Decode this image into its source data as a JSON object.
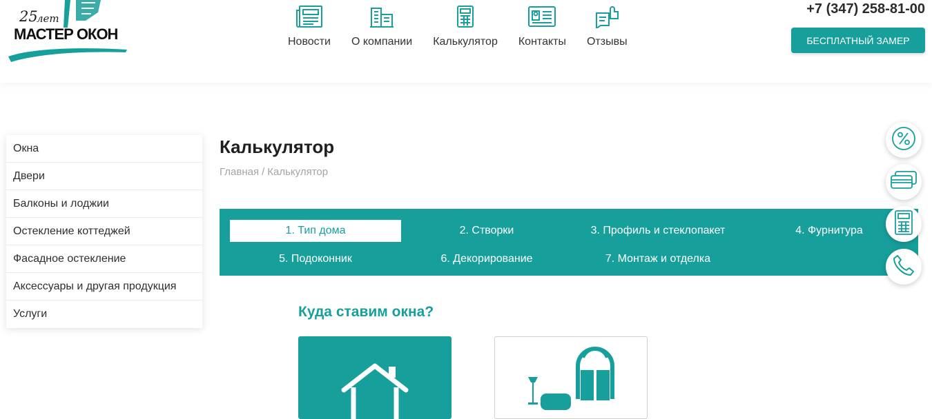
{
  "colors": {
    "accent": "#179f9c",
    "text": "#2e2e2e",
    "muted": "#a3a3a3"
  },
  "logo": {
    "years_number": "25",
    "years_word": "лет",
    "name": "МАСТЕР ОКОН"
  },
  "nav": [
    {
      "label": "Новости",
      "icon": "newspaper-icon"
    },
    {
      "label": "О компании",
      "icon": "buildings-icon"
    },
    {
      "label": "Калькулятор",
      "icon": "calculator-icon"
    },
    {
      "label": "Контакты",
      "icon": "contact-card-icon"
    },
    {
      "label": "Отзывы",
      "icon": "thumbs-up-icon"
    }
  ],
  "header": {
    "phone": "+7 (347) 258-81-00",
    "cta_label": "БЕСПЛАТНЫЙ ЗАМЕР"
  },
  "sidebar": {
    "items": [
      {
        "label": "Окна"
      },
      {
        "label": "Двери"
      },
      {
        "label": "Балконы и лоджии"
      },
      {
        "label": "Остекление коттеджей"
      },
      {
        "label": "Фасадное остекление"
      },
      {
        "label": "Аксессуары и другая продукция"
      },
      {
        "label": "Услуги"
      }
    ]
  },
  "page": {
    "title": "Калькулятор",
    "breadcrumb": {
      "home": "Главная",
      "separator": "/",
      "current": "Калькулятор"
    }
  },
  "steps": [
    {
      "label": "1. Тип дома",
      "active": true
    },
    {
      "label": "2. Створки",
      "active": false
    },
    {
      "label": "3. Профиль и стеклопакет",
      "active": false
    },
    {
      "label": "4. Фурнитура",
      "active": false
    },
    {
      "label": "5. Подоконник",
      "active": false
    },
    {
      "label": "6. Декорирование",
      "active": false
    },
    {
      "label": "7. Монтаж и отделка",
      "active": false
    }
  ],
  "question": "Куда ставим окна?",
  "options": [
    {
      "icon": "house-icon",
      "selected": true
    },
    {
      "icon": "apartment-interior-icon",
      "selected": false
    }
  ],
  "floating_buttons": [
    {
      "icon": "percent-icon"
    },
    {
      "icon": "credit-card-icon"
    },
    {
      "icon": "calculator-icon"
    },
    {
      "icon": "phone-icon"
    }
  ]
}
